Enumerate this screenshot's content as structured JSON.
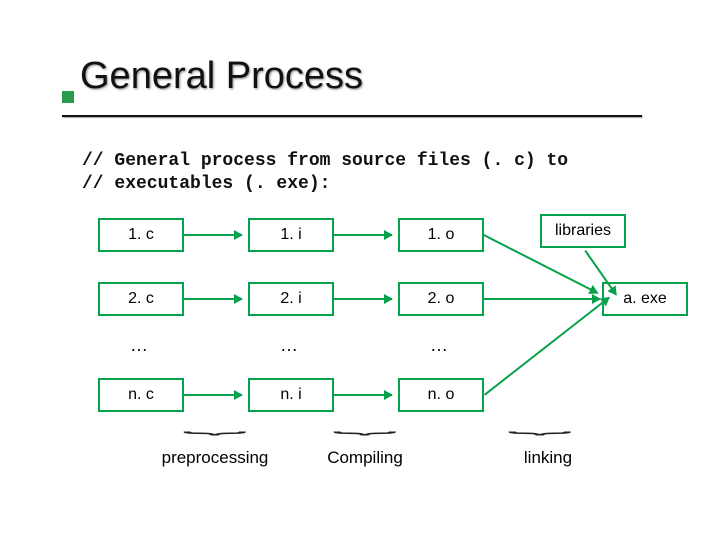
{
  "title": "General Process",
  "subtitle": "// General process from source files (. c) to\n// executables (. exe):",
  "cols": {
    "c": [
      "1. c",
      "2. c",
      "…",
      "n. c"
    ],
    "i": [
      "1. i",
      "2. i",
      "…",
      "n. i"
    ],
    "o": [
      "1. o",
      "2. o",
      "…",
      "n. o"
    ]
  },
  "libraries": "libraries",
  "output": "a. exe",
  "phases": {
    "pre": "preprocessing",
    "compile": "Compiling",
    "link": "linking"
  }
}
